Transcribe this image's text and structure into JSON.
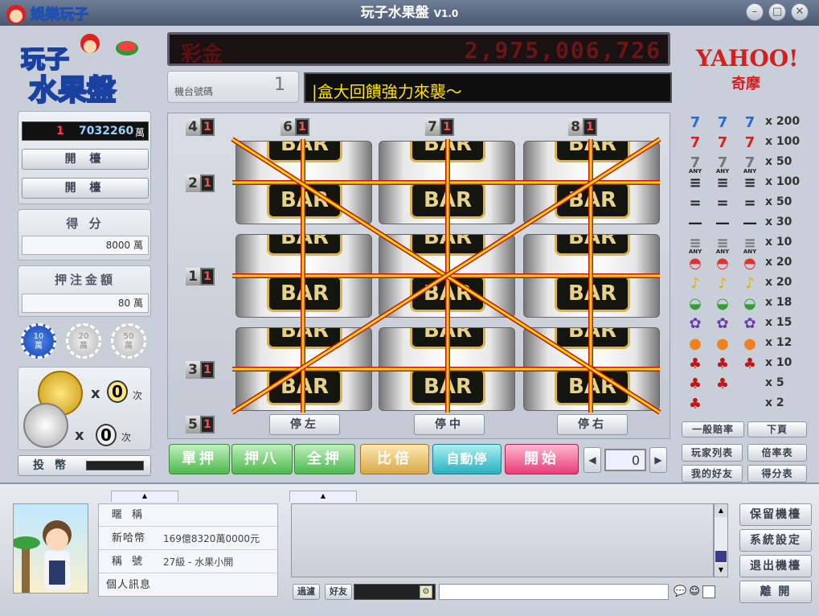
{
  "window": {
    "brand": "娛樂玩子",
    "title": "玩子水果盤",
    "version": "V1.0",
    "controls": [
      "minimize",
      "maximize",
      "close"
    ]
  },
  "logo": {
    "line1": "玩子",
    "line2": "水果盤"
  },
  "jackpot": {
    "label": "彩金",
    "value": "2,975,006,726"
  },
  "machine": {
    "label": "機台號碼",
    "number": "1"
  },
  "marquee": {
    "text": "|盒大回饋強力來襲～"
  },
  "left_panel": {
    "credit_index": "1",
    "credit_value": "7032260",
    "credit_unit": "萬",
    "buttons": [
      "開 檯",
      "開 檯"
    ],
    "score_label": "得 分",
    "score_value": "8000 萬",
    "bet_label": "押注金額",
    "bet_value": "80 萬",
    "chips": [
      {
        "value": "10",
        "unit": "萬",
        "active": true
      },
      {
        "value": "20",
        "unit": "萬",
        "active": false
      },
      {
        "value": "50",
        "unit": "萬",
        "active": false
      }
    ],
    "gold_coin_count": "0",
    "silver_coin_count": "0",
    "coin_x": "x",
    "coin_unit": "次",
    "insert_coin": "投 幣"
  },
  "reels": {
    "symbol": "BAR",
    "line_tags": {
      "top": [
        {
          "n": "4",
          "c": "1"
        },
        {
          "n": "6",
          "c": "1"
        },
        {
          "n": "7",
          "c": "1"
        },
        {
          "n": "8",
          "c": "1"
        }
      ],
      "left": [
        {
          "n": "2",
          "c": "1"
        },
        {
          "n": "1",
          "c": "1"
        },
        {
          "n": "3",
          "c": "1"
        },
        {
          "n": "5",
          "c": "1"
        }
      ]
    },
    "stop_buttons": [
      "停左",
      "停中",
      "停右"
    ],
    "line_color": "#f5d000",
    "line_outline": "#c0141a"
  },
  "controls": {
    "single_bet": "單押",
    "bet_eight": "押八",
    "all_bet": "全押",
    "double": "比倍",
    "auto_stop": "自動停",
    "start": "開始",
    "counter_value": "0"
  },
  "sponsor": {
    "name": "YAHOO!",
    "sub": "奇摩"
  },
  "paytable": {
    "rows": [
      {
        "symbol": "seven-blue",
        "mult": "x 200"
      },
      {
        "symbol": "seven-red",
        "mult": "x 100"
      },
      {
        "symbol": "seven-any",
        "mult": "x 50",
        "tag": "ANY"
      },
      {
        "symbol": "bar-triple",
        "mult": "x 100"
      },
      {
        "symbol": "bar-double",
        "mult": "x 50"
      },
      {
        "symbol": "bar-single",
        "mult": "x 30"
      },
      {
        "symbol": "bar-any",
        "mult": "x 10",
        "tag": "ANY"
      },
      {
        "symbol": "watermelon-slice",
        "mult": "x 20"
      },
      {
        "symbol": "bell",
        "mult": "x 20"
      },
      {
        "symbol": "melon",
        "mult": "x 18"
      },
      {
        "symbol": "grape",
        "mult": "x 15"
      },
      {
        "symbol": "orange",
        "mult": "x 12"
      },
      {
        "symbol": "cherry-3",
        "mult": "x 10"
      },
      {
        "symbol": "cherry-2",
        "mult": "x 5"
      },
      {
        "symbol": "cherry-1",
        "mult": "x 2"
      }
    ],
    "footer_label": "一般賠率",
    "next_page": "下頁"
  },
  "right_buttons": [
    "玩家列表",
    "倍率表",
    "我的好友",
    "得分表"
  ],
  "player": {
    "rows": [
      {
        "label": "暱 稱",
        "value": ""
      },
      {
        "label": "新哈幣",
        "value": "169億8320萬0000元"
      },
      {
        "label": "稱 號",
        "value": "27級 - 水果小開"
      },
      {
        "label": "個人訊息",
        "value": ""
      }
    ]
  },
  "chat": {
    "filter": "過濾",
    "friends": "好友"
  },
  "system_buttons": [
    "保留機檯",
    "系統設定",
    "退出機檯",
    "離 開"
  ]
}
